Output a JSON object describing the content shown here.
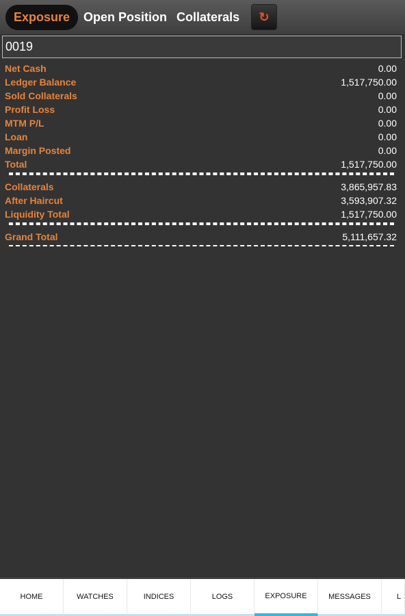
{
  "tabs": [
    {
      "label": "Exposure",
      "active": true
    },
    {
      "label": "Open Position"
    },
    {
      "label": "Collaterals"
    }
  ],
  "refresh_icon": "refresh-icon",
  "account": "0019",
  "accent": "#e8833a",
  "group1": [
    {
      "label": "Net Cash",
      "value": "0.00"
    },
    {
      "label": "Ledger Balance",
      "value": "1,517,750.00"
    },
    {
      "label": "Sold Collaterals",
      "value": "0.00"
    },
    {
      "label": "Profit Loss",
      "value": "0.00"
    },
    {
      "label": "MTM P/L",
      "value": "0.00"
    },
    {
      "label": "Loan",
      "value": "0.00"
    },
    {
      "label": "Margin Posted",
      "value": "0.00"
    },
    {
      "label": "Total",
      "value": "1,517,750.00"
    }
  ],
  "group2": [
    {
      "label": "Collaterals",
      "value": "3,865,957.83"
    },
    {
      "label": "After Haircut",
      "value": "3,593,907.32"
    },
    {
      "label": "Liquidity Total",
      "value": "1,517,750.00"
    }
  ],
  "grand": {
    "label": "Grand Total",
    "value": "5,111,657.32"
  },
  "nav": [
    "HOME",
    "WATCHES",
    "INDICES",
    "LOGS",
    "EXPOSURE",
    "MESSAGES",
    "L"
  ],
  "nav_active": "EXPOSURE"
}
